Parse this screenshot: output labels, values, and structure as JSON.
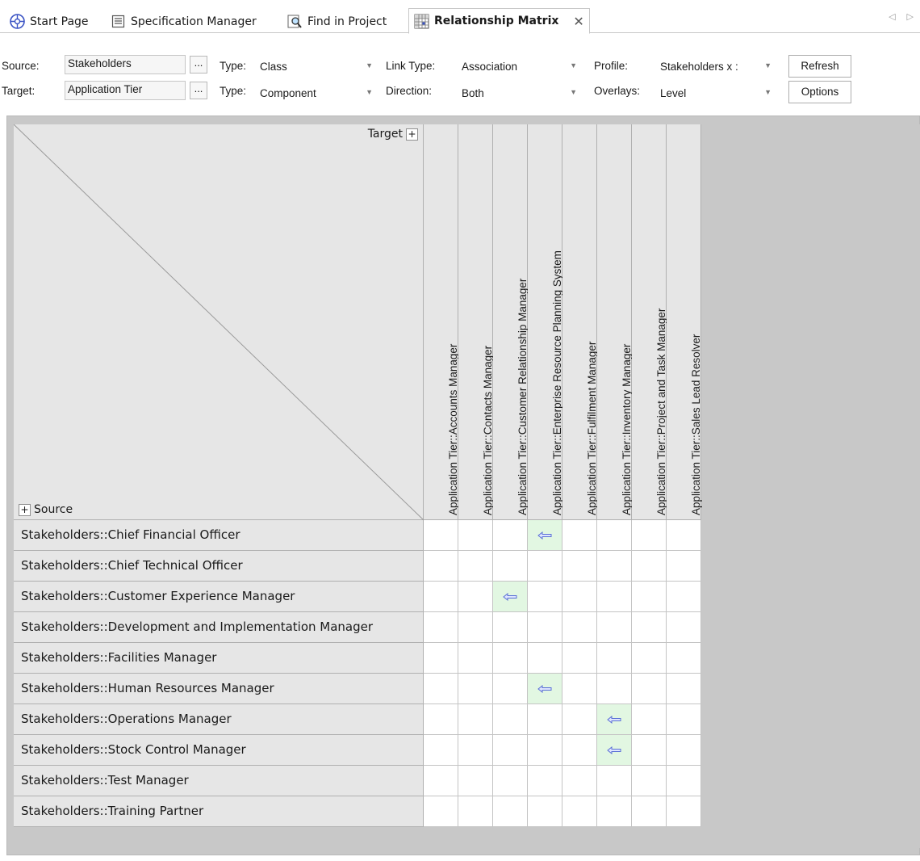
{
  "tabs": [
    {
      "label": "Start Page",
      "icon": "start-page-icon"
    },
    {
      "label": "Specification Manager",
      "icon": "specification-icon"
    },
    {
      "label": "Find in Project",
      "icon": "find-icon"
    },
    {
      "label": "Relationship Matrix",
      "icon": "matrix-icon",
      "active": true
    }
  ],
  "tab_close": "✕",
  "toolbar": {
    "source_label": "Source:",
    "source_value": "Stakeholders",
    "target_label": "Target:",
    "target_value": "Application Tier",
    "browse": "...",
    "type_label": "Type:",
    "source_type": "Class",
    "target_type": "Component",
    "link_type_label": "Link Type:",
    "link_type": "Association",
    "direction_label": "Direction:",
    "direction": "Both",
    "profile_label": "Profile:",
    "profile": "Stakeholders x :",
    "overlays_label": "Overlays:",
    "overlays": "Level",
    "refresh": "Refresh",
    "options": "Options"
  },
  "matrix": {
    "target_header": "Target",
    "source_header": "Source",
    "expand": "+",
    "columns": [
      "Application Tier::Accounts Manager",
      "Application Tier::Contacts Manager",
      "Application Tier::Customer Relationship Manager",
      "Application Tier::Enterprise Resource Planning System",
      "Application Tier::Fulfilment Manager",
      "Application Tier::Inventory Manager",
      "Application Tier::Project and Task Manager",
      "Application Tier::Sales Lead Resolver"
    ],
    "rows": [
      "Stakeholders::Chief Financial Officer",
      "Stakeholders::Chief Technical Officer",
      "Stakeholders::Customer Experience Manager",
      "Stakeholders::Development and Implementation Manager",
      "Stakeholders::Facilities Manager",
      "Stakeholders::Human Resources Manager",
      "Stakeholders::Operations Manager",
      "Stakeholders::Stock Control Manager",
      "Stakeholders::Test Manager",
      "Stakeholders::Training Partner"
    ],
    "relationships": [
      {
        "row": 0,
        "col": 3,
        "direction": "arrow-left"
      },
      {
        "row": 2,
        "col": 2,
        "direction": "arrow-left"
      },
      {
        "row": 5,
        "col": 3,
        "direction": "arrow-left"
      },
      {
        "row": 6,
        "col": 5,
        "direction": "arrow-left"
      },
      {
        "row": 7,
        "col": 5,
        "direction": "arrow-left"
      }
    ],
    "colors": {
      "relationship_cell": "#e2f7e2",
      "arrow": "#5a6fd6"
    }
  }
}
